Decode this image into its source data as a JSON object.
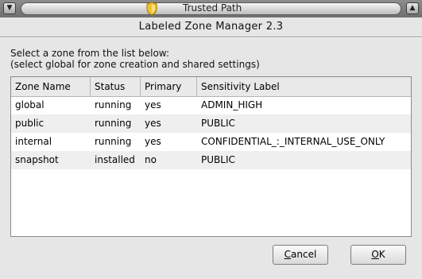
{
  "window": {
    "title": "Trusted Path",
    "menu_icon": "chevron-down-icon",
    "maximize_icon": "chevron-up-icon",
    "shield_icon": "shield-icon"
  },
  "dialog": {
    "heading": "Labeled Zone Manager 2.3",
    "instruction_line1": "Select a zone from the list below:",
    "instruction_line2": "(select global for zone creation and shared settings)"
  },
  "table": {
    "columns": [
      "Zone Name",
      "Status",
      "Primary",
      "Sensitivity Label"
    ],
    "rows": [
      [
        "global",
        "running",
        "yes",
        "ADMIN_HIGH"
      ],
      [
        "public",
        "running",
        "yes",
        "PUBLIC"
      ],
      [
        "internal",
        "running",
        "yes",
        "CONFIDENTIAL_:_INTERNAL_USE_ONLY"
      ],
      [
        "snapshot",
        "installed",
        "no",
        "PUBLIC"
      ]
    ]
  },
  "buttons": {
    "cancel_mnemonic": "C",
    "cancel_rest": "ancel",
    "ok_mnemonic": "O",
    "ok_rest": "K"
  }
}
